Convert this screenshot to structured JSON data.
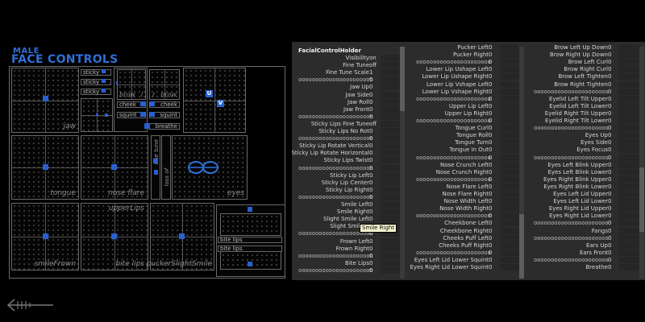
{
  "rig": {
    "title_small": "MALE",
    "title_big": "FACE CONTROLS",
    "labels": {
      "jaw": "jaw",
      "tongue": "tongue",
      "nose_flare": "nose flare",
      "eyes": "eyes",
      "upper_lips": "upperLips",
      "smile_frown": "smileFrown",
      "bite_lips": "bite lips",
      "pucker": "puckerSlightSmile",
      "brow_l": "brow",
      "brow_r": "brow",
      "l": "l",
      "r": "r",
      "cheek_l": "cheek",
      "cheek_r": "cheek",
      "squint_l": "squint",
      "squint_r": "squint",
      "breathe": "breathe",
      "fine_tune": "fine tune",
      "loss_of": "loss of",
      "sticky1": "sticky",
      "sticky2": "sticky",
      "sticky3": "sticky",
      "bite_lips_top": "bite lips",
      "bite_lips_bottom": "bite lips",
      "lower": "lower",
      "upper": "upper"
    },
    "buttons": {
      "u": "U",
      "v": "V"
    },
    "accent": "#2a5fd0"
  },
  "channels": {
    "header": "FacialControlHolder",
    "col1": [
      {
        "label": "Visibility",
        "value": "on"
      },
      {
        "label": "Fine Tune",
        "value": "off"
      },
      {
        "label": "Fine Tune Scale",
        "value": "1"
      },
      {
        "label": "oooooooooooooooooooooo",
        "value": "0"
      },
      {
        "label": "Jaw Up",
        "value": "0"
      },
      {
        "label": "Jaw Side",
        "value": "0"
      },
      {
        "label": "Jaw Roll",
        "value": "0"
      },
      {
        "label": "Jaw Front",
        "value": "0"
      },
      {
        "label": "oooooooooooooooooooooo",
        "value": "0"
      },
      {
        "label": "Sticky Lips Fine Tune",
        "value": "off"
      },
      {
        "label": "Sticky Lips No Rot",
        "value": "0"
      },
      {
        "label": "oooooooooooooooooooooo",
        "value": "0"
      },
      {
        "label": "Sticky Lip Rotate Vertical",
        "value": "0"
      },
      {
        "label": "Sticky Lip Rotate Horizontal",
        "value": "0"
      },
      {
        "label": "Sticky Lips Twist",
        "value": "0"
      },
      {
        "label": "oooooooooooooooooooooo",
        "value": "0"
      },
      {
        "label": "Sticky Lip Left",
        "value": "0"
      },
      {
        "label": "Sticky Lip Center",
        "value": "0"
      },
      {
        "label": "Sticky Lip Right",
        "value": "0"
      },
      {
        "label": "oooooooooooooooooooooo",
        "value": "0"
      },
      {
        "label": "Smile Left",
        "value": "0"
      },
      {
        "label": "Smile Right",
        "value": "0"
      },
      {
        "label": "Slight Smile Left",
        "value": "0"
      },
      {
        "label": "Slight Smile R",
        "value": "0"
      },
      {
        "label": "oooooooooooooooooooooo",
        "value": "0"
      },
      {
        "label": "Frown Left",
        "value": "0"
      },
      {
        "label": "Frown Right",
        "value": "0"
      },
      {
        "label": "oooooooooooooooooooooo",
        "value": "0"
      },
      {
        "label": "Bite Lips",
        "value": "0"
      },
      {
        "label": "oooooooooooooooooooooo",
        "value": "0"
      }
    ],
    "col2": [
      {
        "label": "Pucker Left",
        "value": "0"
      },
      {
        "label": "Pucker Right",
        "value": "0"
      },
      {
        "label": "oooooooooooooooooooooo",
        "value": "0"
      },
      {
        "label": "Lower Lip Ushape Left",
        "value": "0"
      },
      {
        "label": "Lower Lip Ushape Right",
        "value": "0"
      },
      {
        "label": "Lower Lip Vshape Left",
        "value": "0"
      },
      {
        "label": "Lower Lip Vshape Right",
        "value": "0"
      },
      {
        "label": "oooooooooooooooooooooo",
        "value": "0"
      },
      {
        "label": "Upper Lip Left",
        "value": "0"
      },
      {
        "label": "Upper Lip Right",
        "value": "0"
      },
      {
        "label": "oooooooooooooooooooooo",
        "value": "0"
      },
      {
        "label": "Tongue Curl",
        "value": "0"
      },
      {
        "label": "Tongue Roll",
        "value": "0"
      },
      {
        "label": "Tongue Turn",
        "value": "0"
      },
      {
        "label": "Tongue In Out",
        "value": "0"
      },
      {
        "label": "oooooooooooooooooooooo",
        "value": "0"
      },
      {
        "label": "Nose Crunch Left",
        "value": "0"
      },
      {
        "label": "Nose Crunch Right",
        "value": "0"
      },
      {
        "label": "oooooooooooooooooooooo",
        "value": "0"
      },
      {
        "label": "Nose Flare Left",
        "value": "0"
      },
      {
        "label": "Nose Flare Right",
        "value": "0"
      },
      {
        "label": "Nose Width Left",
        "value": "0"
      },
      {
        "label": "Nose Width Right",
        "value": "0"
      },
      {
        "label": "oooooooooooooooooooooo",
        "value": "0"
      },
      {
        "label": "Cheekbone Left",
        "value": "0"
      },
      {
        "label": "Cheekbone Right",
        "value": "0"
      },
      {
        "label": "Cheeks Puff Left",
        "value": "0"
      },
      {
        "label": "Cheeks Puff Right",
        "value": "0"
      },
      {
        "label": "oooooooooooooooooooooo",
        "value": "0"
      },
      {
        "label": "Eyes Left Lid Lower Squint",
        "value": "0"
      },
      {
        "label": "Eyes Right Lid Lower Squint",
        "value": "0"
      }
    ],
    "col3": [
      {
        "label": "Brow Left Up Down",
        "value": "0"
      },
      {
        "label": "Brow Right Up Down",
        "value": "0"
      },
      {
        "label": "Brow Left Curl",
        "value": "0"
      },
      {
        "label": "Brow Right Curl",
        "value": "0"
      },
      {
        "label": "Brow Left Tighten",
        "value": "0"
      },
      {
        "label": "Brow Right Tighten",
        "value": "0"
      },
      {
        "label": "oooooooooooooooooooooo",
        "value": "0"
      },
      {
        "label": "Eyelid Left Tilt Upper",
        "value": "0"
      },
      {
        "label": "Eyelid Left Tilt Lower",
        "value": "0"
      },
      {
        "label": "Eyelid Right Tilt Upper",
        "value": "0"
      },
      {
        "label": "Eyelid Right Tilt Lower",
        "value": "0"
      },
      {
        "label": "oooooooooooooooooooooo",
        "value": "0"
      },
      {
        "label": "Eyes Up",
        "value": "0"
      },
      {
        "label": "Eyes Side",
        "value": "0"
      },
      {
        "label": "Eyes Focus",
        "value": "0"
      },
      {
        "label": "oooooooooooooooooooooo",
        "value": "0"
      },
      {
        "label": "Eyes Left Blink Upper",
        "value": "0"
      },
      {
        "label": "Eyes Left Blink Lower",
        "value": "0"
      },
      {
        "label": "Eyes Right Blink Upper",
        "value": "0"
      },
      {
        "label": "Eyes Right Blink Lower",
        "value": "0"
      },
      {
        "label": "Eyes Left Lid Upper",
        "value": "0"
      },
      {
        "label": "Eyes Left Lid Lower",
        "value": "0"
      },
      {
        "label": "Eyes Right Lid Upper",
        "value": "0"
      },
      {
        "label": "Eyes Right Lid Lower",
        "value": "0"
      },
      {
        "label": "oooooooooooooooooooooo",
        "value": "0"
      },
      {
        "label": "Fangs",
        "value": "0"
      },
      {
        "label": "oooooooooooooooooooooo",
        "value": "0"
      },
      {
        "label": "Ears Up",
        "value": "0"
      },
      {
        "label": "Ears Front",
        "value": "0"
      },
      {
        "label": "oooooooooooooooooooooo",
        "value": "0"
      },
      {
        "label": "Breathe",
        "value": "0"
      }
    ],
    "tooltip": "Smile Right"
  }
}
